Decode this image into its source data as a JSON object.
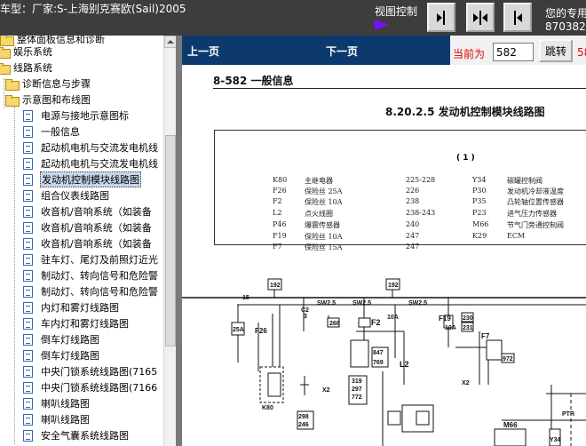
{
  "topbar": {
    "car_model": "车型：厂家:S-上海别克赛欧(Sail)2005",
    "view_control_label": "视图控制",
    "user_info_line1": "您的专用",
    "user_info_line2": "8703820",
    "icons": [
      "view-right-icon",
      "view-center-icon",
      "view-left-icon"
    ]
  },
  "sidebar": {
    "items": [
      {
        "label": "整体面板信息和诊断",
        "icon": "folder-icon"
      },
      {
        "label": "娱乐系统",
        "icon": "folder-icon"
      },
      {
        "label": "线路系统",
        "icon": "folder-icon"
      },
      {
        "label": "诊断信息与步骤",
        "icon": "folder-icon"
      },
      {
        "label": "示意图和布线图",
        "icon": "folder-open-icon"
      },
      {
        "label": "电源与接地示意图标",
        "icon": "document-icon"
      },
      {
        "label": "一般信息",
        "icon": "document-icon"
      },
      {
        "label": "起动机电机与交流发电机线",
        "icon": "document-icon"
      },
      {
        "label": "起动机电机与交流发电机线",
        "icon": "document-icon"
      },
      {
        "label": "发动机控制模块线路图",
        "icon": "document-icon",
        "selected": true
      },
      {
        "label": "组合仪表线路图",
        "icon": "document-icon"
      },
      {
        "label": "收音机/音响系统（如装备",
        "icon": "document-icon"
      },
      {
        "label": "收音机/音响系统（如装备",
        "icon": "document-icon"
      },
      {
        "label": "收音机/音响系统（如装备",
        "icon": "document-icon"
      },
      {
        "label": "驻车灯、尾灯及前照灯近光",
        "icon": "document-icon"
      },
      {
        "label": "制动灯、转向信号和危险警",
        "icon": "document-icon"
      },
      {
        "label": "制动灯、转向信号和危险警",
        "icon": "document-icon"
      },
      {
        "label": "内灯和雾灯线路图",
        "icon": "document-icon"
      },
      {
        "label": "车内灯和雾灯线路图",
        "icon": "document-icon"
      },
      {
        "label": "倒车灯线路图",
        "icon": "document-icon"
      },
      {
        "label": "倒车灯线路图",
        "icon": "document-icon"
      },
      {
        "label": "中央门锁系统线路图(7165",
        "icon": "document-icon"
      },
      {
        "label": "中央门锁系统线路图(7166",
        "icon": "document-icon"
      },
      {
        "label": "喇叭线路图",
        "icon": "document-icon"
      },
      {
        "label": "喇叭线路图",
        "icon": "document-icon"
      },
      {
        "label": "安全气囊系统线路图",
        "icon": "document-icon"
      }
    ]
  },
  "nav": {
    "prev_label": "上一页",
    "next_label": "下一页",
    "current_label": "当前为",
    "page_value": "582",
    "jump_label": "跳转",
    "page_count": "58"
  },
  "document": {
    "header": "8-582    一般信息",
    "diagram_title": "8.20.2.5 发动机控制模块线路图",
    "legend_number": "( 1 )",
    "legend_left": [
      {
        "code": "K80",
        "name": "主继电器",
        "ref": "225-228"
      },
      {
        "code": "F26",
        "name": "保险丝 25A",
        "ref": "226"
      },
      {
        "code": "F2",
        "name": "保险丝 10A",
        "ref": "238"
      },
      {
        "code": "L2",
        "name": "点火线圈",
        "ref": "238-243"
      },
      {
        "code": "P46",
        "name": "爆震传感器",
        "ref": "240"
      },
      {
        "code": "F19",
        "name": "保险丝 10A",
        "ref": "247"
      },
      {
        "code": "F7",
        "name": "保险丝 15A",
        "ref": "247"
      }
    ],
    "legend_right": [
      {
        "code": "Y34",
        "name": "碳罐控制阀"
      },
      {
        "code": "P30",
        "name": "发动机冷却液温度"
      },
      {
        "code": "P35",
        "name": "凸轮轴位置传感器"
      },
      {
        "code": "P23",
        "name": "进气压力传感器"
      },
      {
        "code": "M66",
        "name": "节气门旁通控制阀"
      },
      {
        "code": "K29",
        "name": "ECM"
      }
    ],
    "wiring_labels": {
      "w15": "15",
      "n192a": "192",
      "n192b": "192",
      "sw25a": "SW2.5",
      "sw25b": "SW2.5",
      "sw25c": "SW2.5",
      "c2": "C2",
      "x3": "3",
      "n268": "268",
      "f2": "F2",
      "f2amp": "10A",
      "f19": "F19",
      "f19amp": "10A",
      "n230": "230",
      "n231": "231",
      "f7": "F7",
      "f26": "F26",
      "f26amp": "25A",
      "n847": "847",
      "n769": "769",
      "l2": "L2",
      "n319": "319",
      "n297": "297",
      "n772": "772",
      "n972": "972",
      "k80": "K80",
      "n298": "298",
      "n246": "246",
      "x2a": "X2",
      "x2b": "X2",
      "m66": "M66",
      "ptr": "PTR",
      "y34": "Y34"
    }
  }
}
